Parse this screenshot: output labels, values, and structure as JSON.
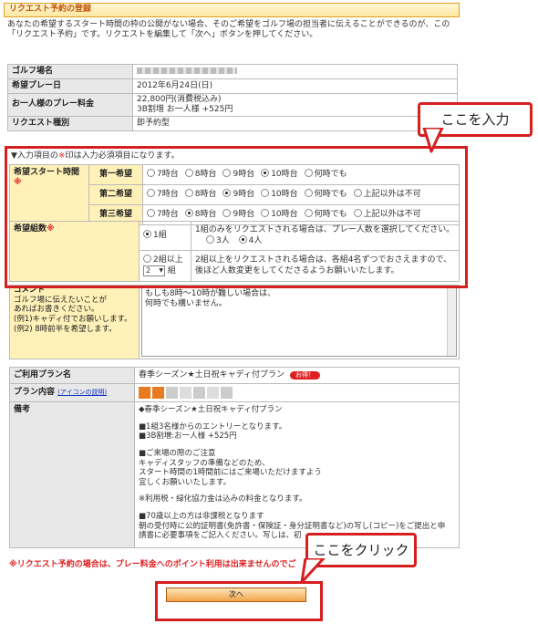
{
  "header": {
    "title": "リクエスト予約の登録"
  },
  "intro": "あなたの希望するスタート時間の枠の公開がない場合、そのご希望をゴルフ場の担当者に伝えることができるのが、この「リクエスト予約」です。リクエストを編集して「次へ」ボタンを押してください。",
  "info": {
    "course_label": "ゴルフ場名",
    "date_label": "希望プレー日",
    "date_value": "2012年6月24日(日)",
    "fee_label": "お一人様のプレー料金",
    "fee_value1": "22,800円(消費税込み)",
    "fee_value2": "3B割増 お一人様 +525円",
    "type_label": "リクエスト種別",
    "type_value": "即予約型"
  },
  "required_note": {
    "pre": "▼入力項目の",
    "mark": "※",
    "post": "印は入力必須項目になります。"
  },
  "start_time": {
    "label": "希望スタート時間",
    "mark": "※",
    "rows": [
      {
        "label": "第一希望",
        "options": [
          "7時台",
          "8時台",
          "9時台",
          "10時台",
          "何時でも"
        ],
        "selected": 3
      },
      {
        "label": "第二希望",
        "options": [
          "7時台",
          "8時台",
          "9時台",
          "10時台",
          "何時でも",
          "上記以外は不可"
        ],
        "selected": 2
      },
      {
        "label": "第三希望",
        "options": [
          "7時台",
          "8時台",
          "9時台",
          "10時台",
          "何時でも",
          "上記以外は不可"
        ],
        "selected": 1
      }
    ]
  },
  "groups": {
    "label": "希望組数",
    "mark": "※",
    "one_label": "1組",
    "one_desc": "1組のみをリクエストされる場合は、プレー人数を選択してください。",
    "players": [
      "3人",
      "4人"
    ],
    "players_selected": 1,
    "multi_label": "2組以上",
    "multi_select": "2",
    "multi_unit": "組",
    "multi_desc": "2組以上をリクエストされる場合は、各組4名ずつでおさえますので、後ほど人数変更をしてくださるようお願いいたします。"
  },
  "comment": {
    "label": "コメント",
    "help1": "ゴルフ場に伝えたいことが",
    "help2": "あればお書きください。",
    "help3": "(例1)キャディ付でお願いします。",
    "help4": "(例2) 8時前半を希望します。",
    "value1": "もしも8時～10時が難しい場合は、",
    "value2": "何時でも構いません。"
  },
  "plan": {
    "name_label": "ご利用プラン名",
    "name_value": "春季シーズン★土日祝キャディ付プラン",
    "badge": "お得！",
    "content_label": "プラン内容",
    "icon_link": "(アイコンの説明)",
    "remarks_label": "備考",
    "remarks": [
      "◆春季シーズン★土日祝キャディ付プラン",
      "■1組3名様からのエントリーとなります。",
      "■3B割増:お一人様 +525円",
      "■ご来場の際のご注意",
      "キャディスタッフの準備などのため、",
      "スタート時間の1時間前にはご来場いただけますよう",
      "宜しくお願いいたします。",
      "※利用税・緑化協力金は込みの料金となります。",
      "■70歳以上の方は非課税となります",
      "朝の受付時に公的証明書(免許書・保険証・身分証明書など)の写し(コピー)をご提出と申",
      "請書に必要事項をご記入ください。写しは、初"
    ]
  },
  "warning": "※リクエスト予約の場合は、プレー料金へのポイント利用は出来ませんのでご",
  "next_button": "次へ",
  "callouts": {
    "input": "ここを入力",
    "click": "ここをクリック"
  },
  "colors": {
    "accent_red": "#d62020",
    "required_bg": "#fff1b8",
    "label_bg": "#e8e8e8",
    "button_orange": "#f2a44a"
  }
}
